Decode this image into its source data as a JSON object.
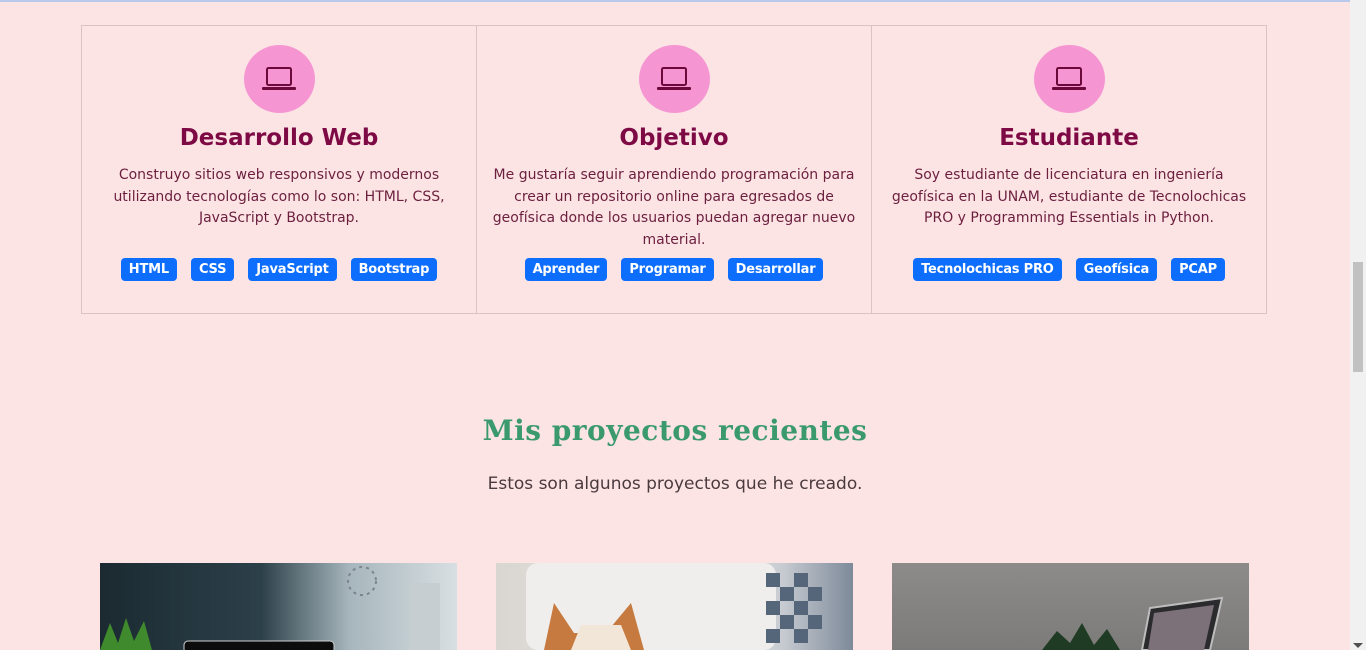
{
  "features": [
    {
      "icon": "laptop-icon",
      "title": "Desarrollo Web",
      "text": "Construyo sitios web responsivos y modernos utilizando tecnologías como lo son: HTML, CSS, JavaScript y Bootstrap.",
      "badges": [
        "HTML",
        "CSS",
        "JavaScript",
        "Bootstrap"
      ]
    },
    {
      "icon": "laptop-icon",
      "title": "Objetivo",
      "text": "Me gustaría seguir aprendiendo programación para crear un repositorio online para egresados de geofísica donde los usuarios puedan agregar nuevo material.",
      "badges": [
        "Aprender",
        "Programar",
        "Desarrollar"
      ]
    },
    {
      "icon": "laptop-icon",
      "title": "Estudiante",
      "text": "Soy estudiante de licenciatura en ingeniería geofísica en la UNAM, estudiante de Tecnolochicas PRO y Programming Essentials in Python.",
      "badges": [
        "Tecnolochicas PRO",
        "Geofísica",
        "PCAP"
      ]
    }
  ],
  "projects": {
    "title": "Mis proyectos recientes",
    "subtitle": "Estos son algunos proyectos que he creado."
  },
  "colors": {
    "background": "#fde4e4",
    "accent_circle": "#f596d3",
    "title": "#7d0a45",
    "badge": "#0d6efd",
    "projects_title": "#3a9a6e"
  }
}
